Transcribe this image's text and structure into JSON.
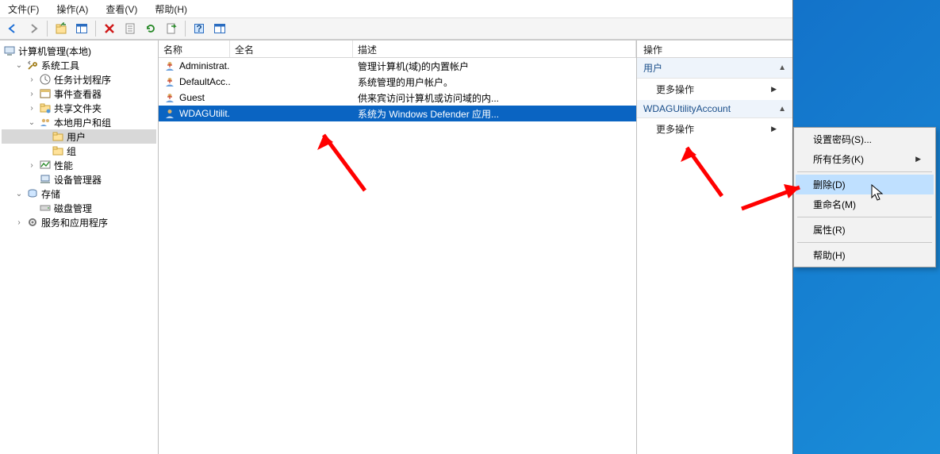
{
  "menubar": {
    "file": "文件(F)",
    "action": "操作(A)",
    "view": "查看(V)",
    "help": "帮助(H)"
  },
  "tree": {
    "root": "计算机管理(本地)",
    "system_tools": "系统工具",
    "task_scheduler": "任务计划程序",
    "event_viewer": "事件查看器",
    "shared_folders": "共享文件夹",
    "local_users_groups": "本地用户和组",
    "users": "用户",
    "groups": "组",
    "performance": "性能",
    "device_manager": "设备管理器",
    "storage": "存储",
    "disk_management": "磁盘管理",
    "services_apps": "服务和应用程序"
  },
  "list": {
    "headers": {
      "name": "名称",
      "fullname": "全名",
      "description": "描述"
    },
    "rows": [
      {
        "name": "Administrat...",
        "fullname": "",
        "description": "管理计算机(域)的内置帐户"
      },
      {
        "name": "DefaultAcc...",
        "fullname": "",
        "description": "系统管理的用户帐户。"
      },
      {
        "name": "Guest",
        "fullname": "",
        "description": "供来宾访问计算机或访问域的内..."
      },
      {
        "name": "WDAGUtilit...",
        "fullname": "",
        "description": "系统为 Windows Defender 应用..."
      }
    ]
  },
  "actions": {
    "title": "操作",
    "group1": "用户",
    "more1": "更多操作",
    "group2": "WDAGUtilityAccount",
    "more2": "更多操作"
  },
  "contextmenu": {
    "set_password": "设置密码(S)...",
    "all_tasks": "所有任务(K)",
    "delete": "删除(D)",
    "rename": "重命名(M)",
    "properties": "属性(R)",
    "help": "帮助(H)"
  }
}
